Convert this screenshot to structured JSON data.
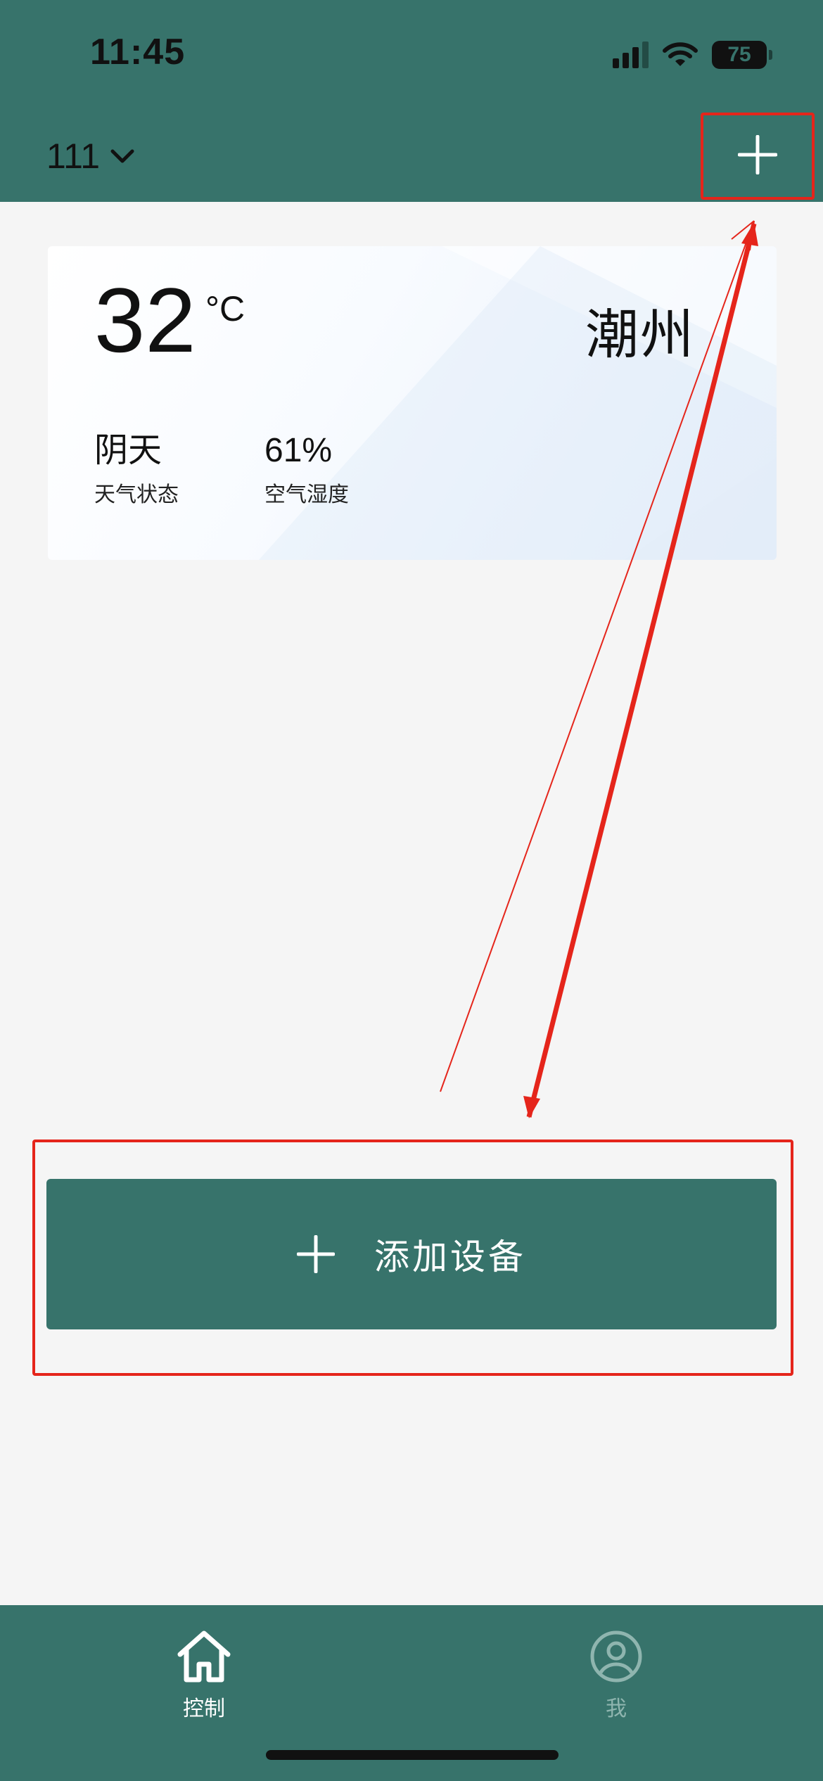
{
  "status_bar": {
    "time": "11:45",
    "battery_level": "75",
    "icons": [
      "signal-icon",
      "wifi-icon",
      "battery-icon"
    ]
  },
  "header": {
    "home_name": "111",
    "home_dropdown_icon": "chevron-down-icon",
    "add_icon": "plus-icon",
    "background_color": "#37736b"
  },
  "weather": {
    "temperature": "32",
    "unit": "°C",
    "city": "潮州",
    "condition_value": "阴天",
    "condition_label": "天气状态",
    "humidity_value": "61%",
    "humidity_label": "空气湿度"
  },
  "add_device": {
    "label": "添加设备",
    "icon": "plus-icon"
  },
  "tabbar": {
    "tabs": [
      {
        "label": "控制",
        "icon": "home-icon",
        "active": true
      },
      {
        "label": "我",
        "icon": "user-icon",
        "active": false
      }
    ]
  },
  "colors": {
    "accent": "#37736b",
    "annotation": "#e5251b",
    "page_bg": "#f5f5f5",
    "inactive_tab": "#8fb5af"
  }
}
